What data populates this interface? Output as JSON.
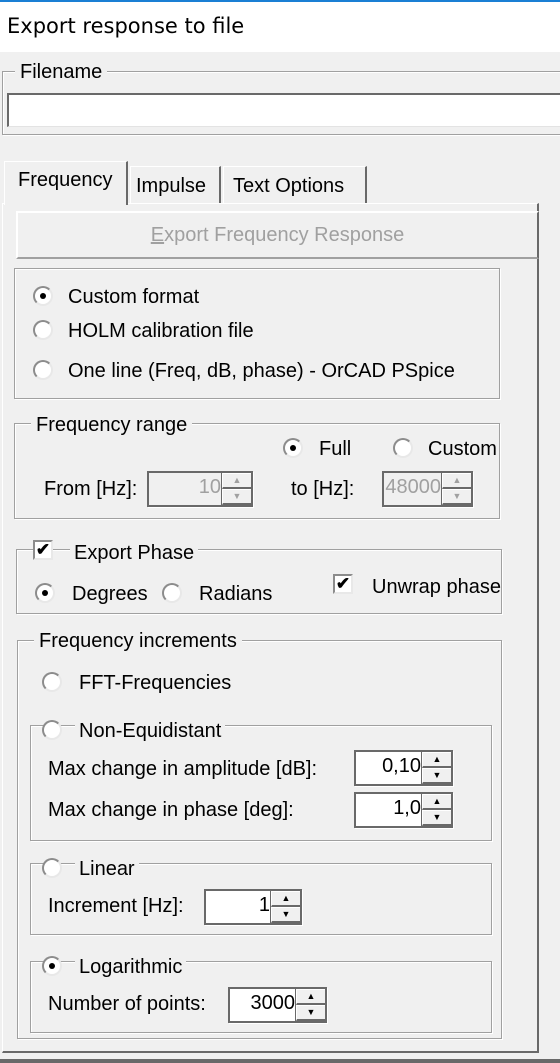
{
  "window": {
    "title": "Export response to file"
  },
  "filename_group": {
    "legend": "Filename",
    "value": "",
    "placeholder": ""
  },
  "tabs": [
    {
      "label": "Frequency",
      "active": true
    },
    {
      "label": "Impulse",
      "active": false
    },
    {
      "label": "Text Options",
      "active": false
    }
  ],
  "export_button": {
    "label_first": "E",
    "label_rest": "xport Frequency Response",
    "enabled": false
  },
  "format_options": [
    {
      "label": "Custom format",
      "checked": true
    },
    {
      "label": "HOLM calibration file",
      "checked": false
    },
    {
      "label": "One line (Freq, dB, phase) - OrCAD PSpice",
      "checked": false
    }
  ],
  "frequency_range": {
    "legend": "Frequency range",
    "full_label": "Full",
    "full_checked": true,
    "custom_label": "Custom",
    "custom_checked": false,
    "from_label": "From [Hz]:",
    "from_value": "10",
    "to_label": "to [Hz]:",
    "to_value": "48000"
  },
  "phase": {
    "export_label": "Export Phase",
    "export_checked": true,
    "degrees_label": "Degrees",
    "degrees_checked": true,
    "radians_label": "Radians",
    "radians_checked": false,
    "unwrap_label": "Unwrap phase",
    "unwrap_checked": true
  },
  "increments": {
    "legend": "Frequency increments",
    "fft_label": "FFT-Frequencies",
    "fft_checked": false,
    "nonequi_label": "Non-Equidistant",
    "nonequi_checked": false,
    "amp_label": "Max change in amplitude [dB]:",
    "amp_value": "0,10",
    "phase_label": "Max change in phase [deg]:",
    "phase_value": "1,0",
    "linear_label": "Linear",
    "linear_checked": false,
    "increment_label": "Increment [Hz]:",
    "increment_value": "1",
    "log_label": "Logarithmic",
    "log_checked": true,
    "points_label": "Number of points:",
    "points_value": "3000"
  },
  "icons": {
    "check": "✔",
    "up": "▲",
    "down": "▼"
  }
}
